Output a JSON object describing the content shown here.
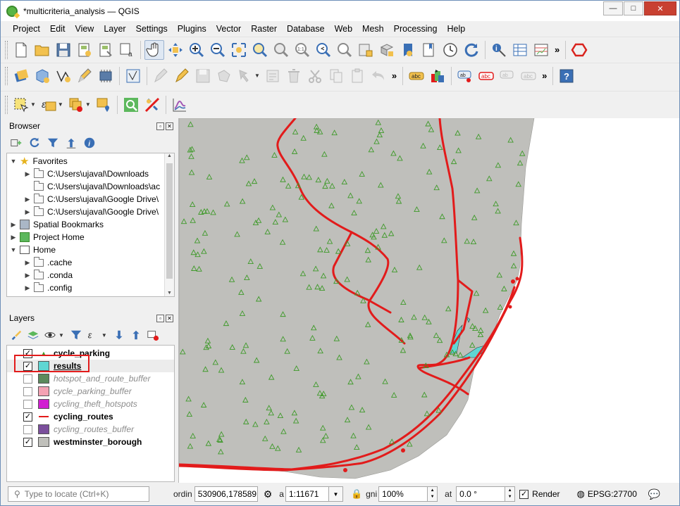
{
  "window": {
    "title": "*multicriteria_analysis — QGIS",
    "minimize": "—",
    "maximize": "□",
    "close": "✕"
  },
  "menu": [
    "Project",
    "Edit",
    "View",
    "Layer",
    "Settings",
    "Plugins",
    "Vector",
    "Raster",
    "Database",
    "Web",
    "Mesh",
    "Processing",
    "Help"
  ],
  "toolbar": {
    "more": "»"
  },
  "browser": {
    "title": "Browser",
    "items": [
      {
        "label": "Favorites"
      },
      {
        "label": "C:\\Users\\ujaval\\Downloads"
      },
      {
        "label": "C:\\Users\\ujaval\\Downloads\\ac"
      },
      {
        "label": "C:\\Users\\ujaval\\Google Drive\\"
      },
      {
        "label": "C:\\Users\\ujaval\\Google Drive\\"
      },
      {
        "label": "Spatial Bookmarks"
      },
      {
        "label": "Project Home"
      },
      {
        "label": "Home"
      },
      {
        "label": ".cache"
      },
      {
        "label": ".conda"
      },
      {
        "label": ".config"
      }
    ]
  },
  "layers": {
    "title": "Layers",
    "items": [
      {
        "label": "cycle_parking",
        "checked": true
      },
      {
        "label": "results",
        "checked": true,
        "color": "#5fd6d3"
      },
      {
        "label": "hotspot_and_route_buffer",
        "checked": false,
        "color": "#5c8a5c"
      },
      {
        "label": "cycle_parking_buffer",
        "checked": false,
        "color": "#f4a2b3"
      },
      {
        "label": "cycling_theft_hotspots",
        "checked": false,
        "color": "#d11ed1"
      },
      {
        "label": "cycling_routes",
        "checked": true,
        "color": "#e21b1b"
      },
      {
        "label": "cycling_routes_buffer",
        "checked": false,
        "color": "#7b4f9c"
      },
      {
        "label": "westminster_borough",
        "checked": true,
        "color": "#c0c0bb"
      }
    ]
  },
  "status": {
    "locate_placeholder": "Type to locate (Ctrl+K)",
    "coord_label": "ordin",
    "coordinate": "530906,178589",
    "scale_label": "a",
    "scale": "1:11671",
    "magnifier_label": "gni",
    "magnifier": "100%",
    "rotation_label": "at",
    "rotation": "0.0 °",
    "render_label": "Render",
    "render_checked": "✓",
    "crs": "EPSG:27700"
  },
  "map": {
    "background": "#bfbfbb",
    "route_color": "#e21b1b",
    "parking_color": "#3f9a2a",
    "results_color": "#5fd6d3"
  }
}
